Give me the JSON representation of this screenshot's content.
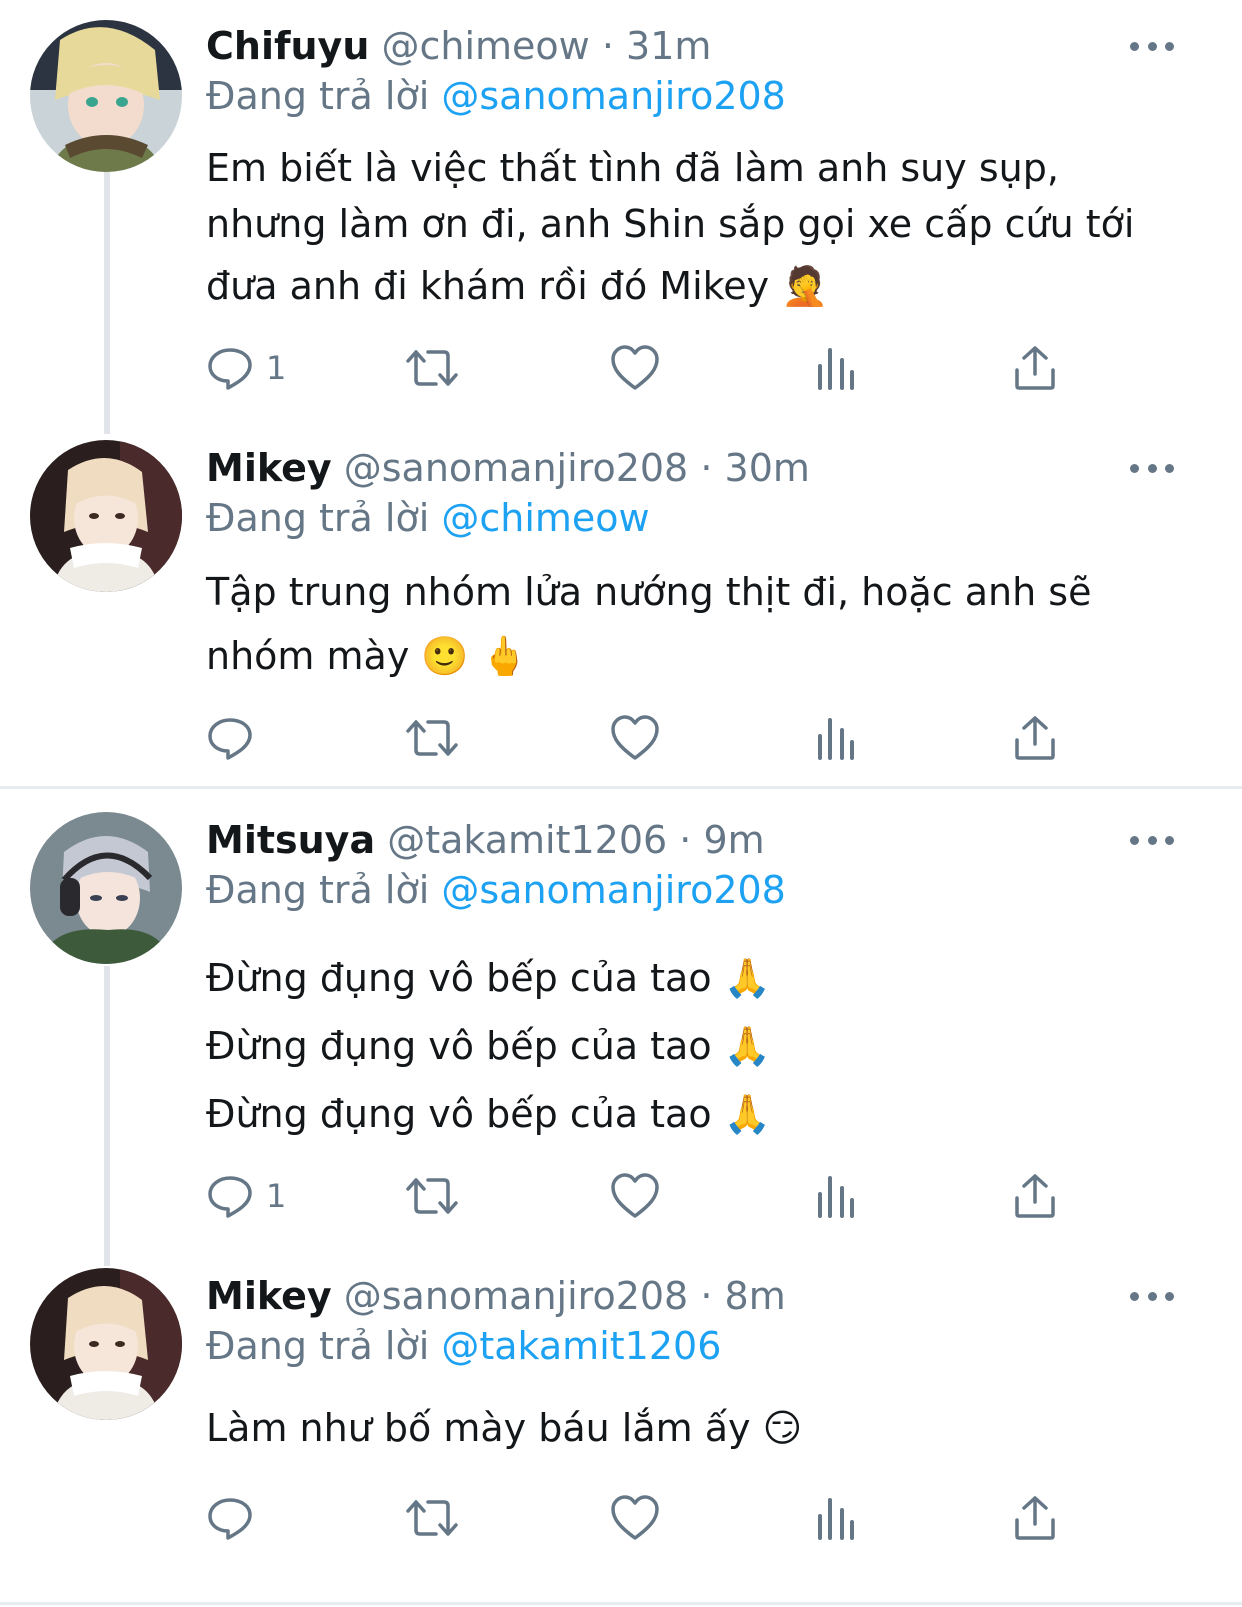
{
  "colors": {
    "text": "#14171a",
    "secondary": "#657786",
    "link": "#1da1f2",
    "line": "#e1e4e8"
  },
  "tweets": [
    {
      "name": "Chifuyu",
      "handle": "@chimeow",
      "time": "31m",
      "reply_prefix": "Đang trả lời",
      "reply_to": "@sanomanjiro208",
      "lines": [
        "Em biết là việc thất tình đã làm anh suy sụp,",
        "nhưng làm ơn đi, anh Shin sắp gọi xe cấp cứu tới",
        "đưa anh đi khám rồi đó Mikey 🤦"
      ],
      "reply_count": "1",
      "avatar_icon": "avatar-chifuyu"
    },
    {
      "name": "Mikey",
      "handle": "@sanomanjiro208",
      "time": "30m",
      "reply_prefix": "Đang trả lời",
      "reply_to": "@chimeow",
      "lines": [
        "Tập trung nhóm lửa nướng thịt đi, hoặc anh sẽ",
        "nhóm mày 🙂 🖕"
      ],
      "reply_count": "",
      "avatar_icon": "avatar-mikey"
    },
    {
      "name": "Mitsuya",
      "handle": "@takamit1206",
      "time": "9m",
      "reply_prefix": "Đang trả lời",
      "reply_to": "@sanomanjiro208",
      "lines": [
        "Đừng đụng vô bếp của tao 🙏",
        "Đừng đụng vô bếp của tao 🙏",
        "Đừng đụng vô bếp của tao 🙏"
      ],
      "reply_count": "1",
      "avatar_icon": "avatar-mitsuya"
    },
    {
      "name": "Mikey",
      "handle": "@sanomanjiro208",
      "time": "8m",
      "reply_prefix": "Đang trả lời",
      "reply_to": "@takamit1206",
      "lines": [
        "Làm như bố mày báu lắm ấy 😏"
      ],
      "reply_count": "",
      "avatar_icon": "avatar-mikey"
    }
  ],
  "action_icons": [
    "reply-icon",
    "retweet-icon",
    "like-icon",
    "analytics-icon",
    "share-icon"
  ],
  "separator": "·"
}
